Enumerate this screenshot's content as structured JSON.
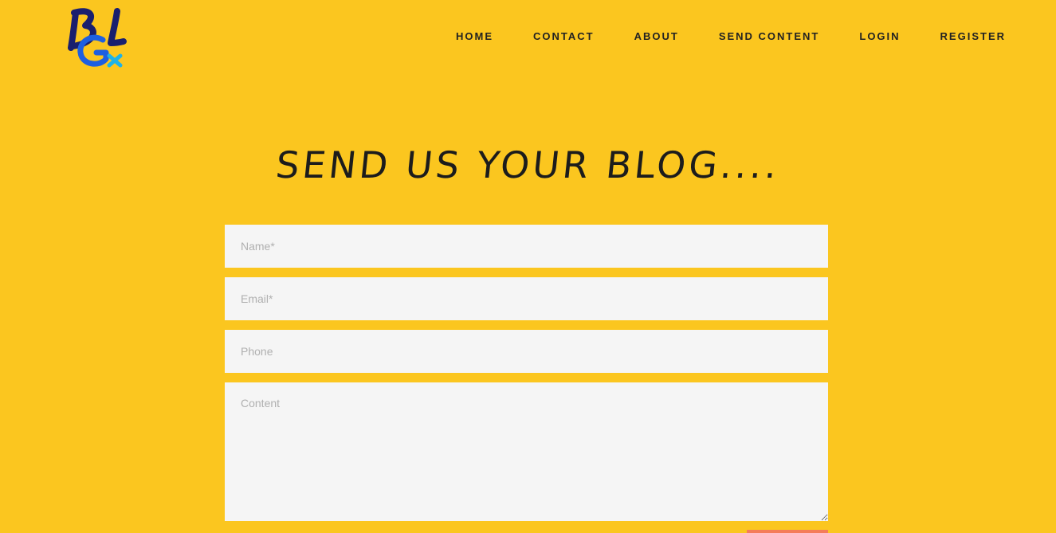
{
  "logo": {
    "text": "BLGx",
    "icon": "blgx-logo"
  },
  "nav": {
    "items": [
      {
        "label": "HOME"
      },
      {
        "label": "CONTACT"
      },
      {
        "label": "ABOUT"
      },
      {
        "label": "SEND CONTENT"
      },
      {
        "label": "LOGIN"
      },
      {
        "label": "REGISTER"
      }
    ]
  },
  "heading": "SEND US YOUR BLOG....",
  "form": {
    "name_placeholder": "Name*",
    "email_placeholder": "Email*",
    "phone_placeholder": "Phone",
    "content_placeholder": "Content"
  },
  "colors": {
    "background": "#fbc61f",
    "field_background": "#f5f5f5",
    "submit": "#f47c5a",
    "logo_dark": "#1a1f6e",
    "logo_blue": "#1e5fe0",
    "logo_cyan": "#1fb3e6"
  }
}
